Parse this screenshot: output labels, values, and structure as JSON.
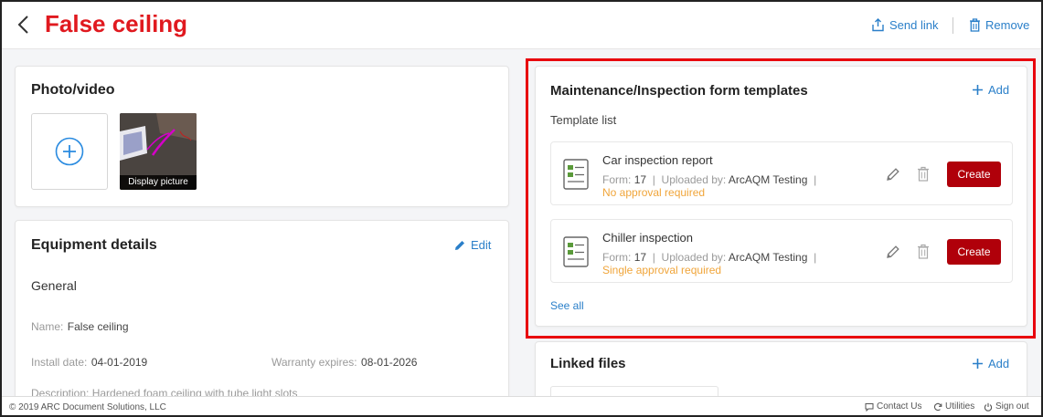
{
  "header": {
    "title": "False ceiling",
    "send_link": "Send link",
    "remove": "Remove"
  },
  "photo": {
    "title": "Photo/video",
    "thumb_caption": "Display picture"
  },
  "equipment": {
    "title": "Equipment details",
    "edit": "Edit",
    "section": "General",
    "name_label": "Name:",
    "name_value": "False ceiling",
    "install_label": "Install date:",
    "install_value": "04-01-2019",
    "warranty_label": "Warranty expires:",
    "warranty_value": "08-01-2026",
    "description_partial": "Description: Hardened foam ceiling with tube light slots"
  },
  "templates": {
    "title": "Maintenance/Inspection form templates",
    "add": "Add",
    "list_label": "Template list",
    "items": [
      {
        "name": "Car inspection report",
        "form_label": "Form:",
        "form_value": "17",
        "uploaded_label": "Uploaded by:",
        "uploaded_value": "ArcAQM Testing",
        "approval": "No approval required",
        "create": "Create"
      },
      {
        "name": "Chiller inspection",
        "form_label": "Form:",
        "form_value": "17",
        "uploaded_label": "Uploaded by:",
        "uploaded_value": "ArcAQM Testing",
        "approval": "Single approval required",
        "create": "Create"
      }
    ],
    "see_all": "See all"
  },
  "linked_files": {
    "title": "Linked files",
    "add": "Add"
  },
  "footer": {
    "copyright": "© 2019 ARC Document Solutions, LLC",
    "contact": "Contact Us",
    "utilities": "Utilities",
    "sign_out": "Sign out"
  },
  "colors": {
    "title_red": "#e0191f",
    "link_blue": "#2a7fc9",
    "create_btn": "#b0000a",
    "approval_orange": "#f0a53a",
    "highlight_red": "#e8000d"
  }
}
